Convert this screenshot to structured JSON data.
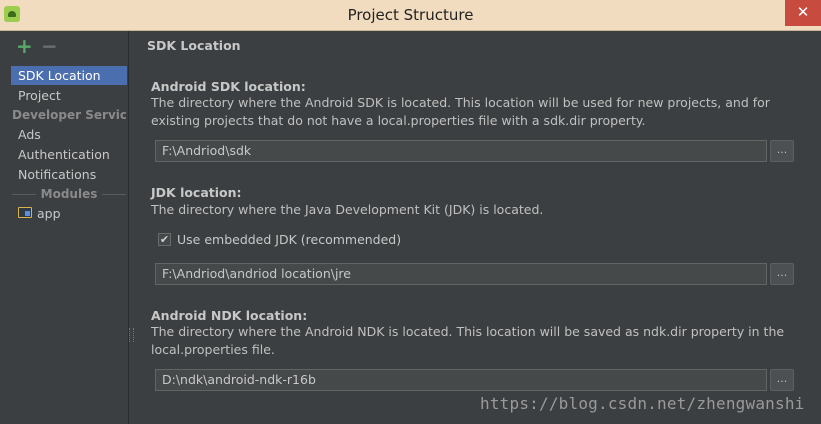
{
  "window": {
    "title": "Project Structure",
    "close_glyph": "✕"
  },
  "sidebar": {
    "add_glyph": "+",
    "remove_glyph": "−",
    "items": [
      {
        "label": "SDK Location"
      },
      {
        "label": "Project"
      },
      {
        "label": "Developer Servic..."
      },
      {
        "label": "Ads"
      },
      {
        "label": "Authentication"
      },
      {
        "label": "Notifications"
      },
      {
        "label": "Modules"
      },
      {
        "label": "app"
      }
    ]
  },
  "main": {
    "section_title": "SDK Location",
    "android_sdk": {
      "label": "Android SDK location:",
      "description": "The directory where the Android SDK is located. This location will be used for new projects, and for existing projects that do not have a local.properties file with a sdk.dir property.",
      "value": "F:\\Andriod\\sdk",
      "browse_label": "..."
    },
    "jdk": {
      "label": "JDK location:",
      "description": "The directory where the Java Development Kit (JDK) is located.",
      "checkbox_label": "Use embedded JDK (recommended)",
      "checkbox_glyph": "✔",
      "value": "F:\\Andriod\\andriod location\\jre",
      "browse_label": "..."
    },
    "ndk": {
      "label": "Android NDK location:",
      "description": "The directory where the Android NDK is located. This location will be saved as ndk.dir property in the local.properties file.",
      "value": "D:\\ndk\\android-ndk-r16b",
      "browse_label": "..."
    }
  },
  "watermark": "https://blog.csdn.net/zhengwanshi"
}
